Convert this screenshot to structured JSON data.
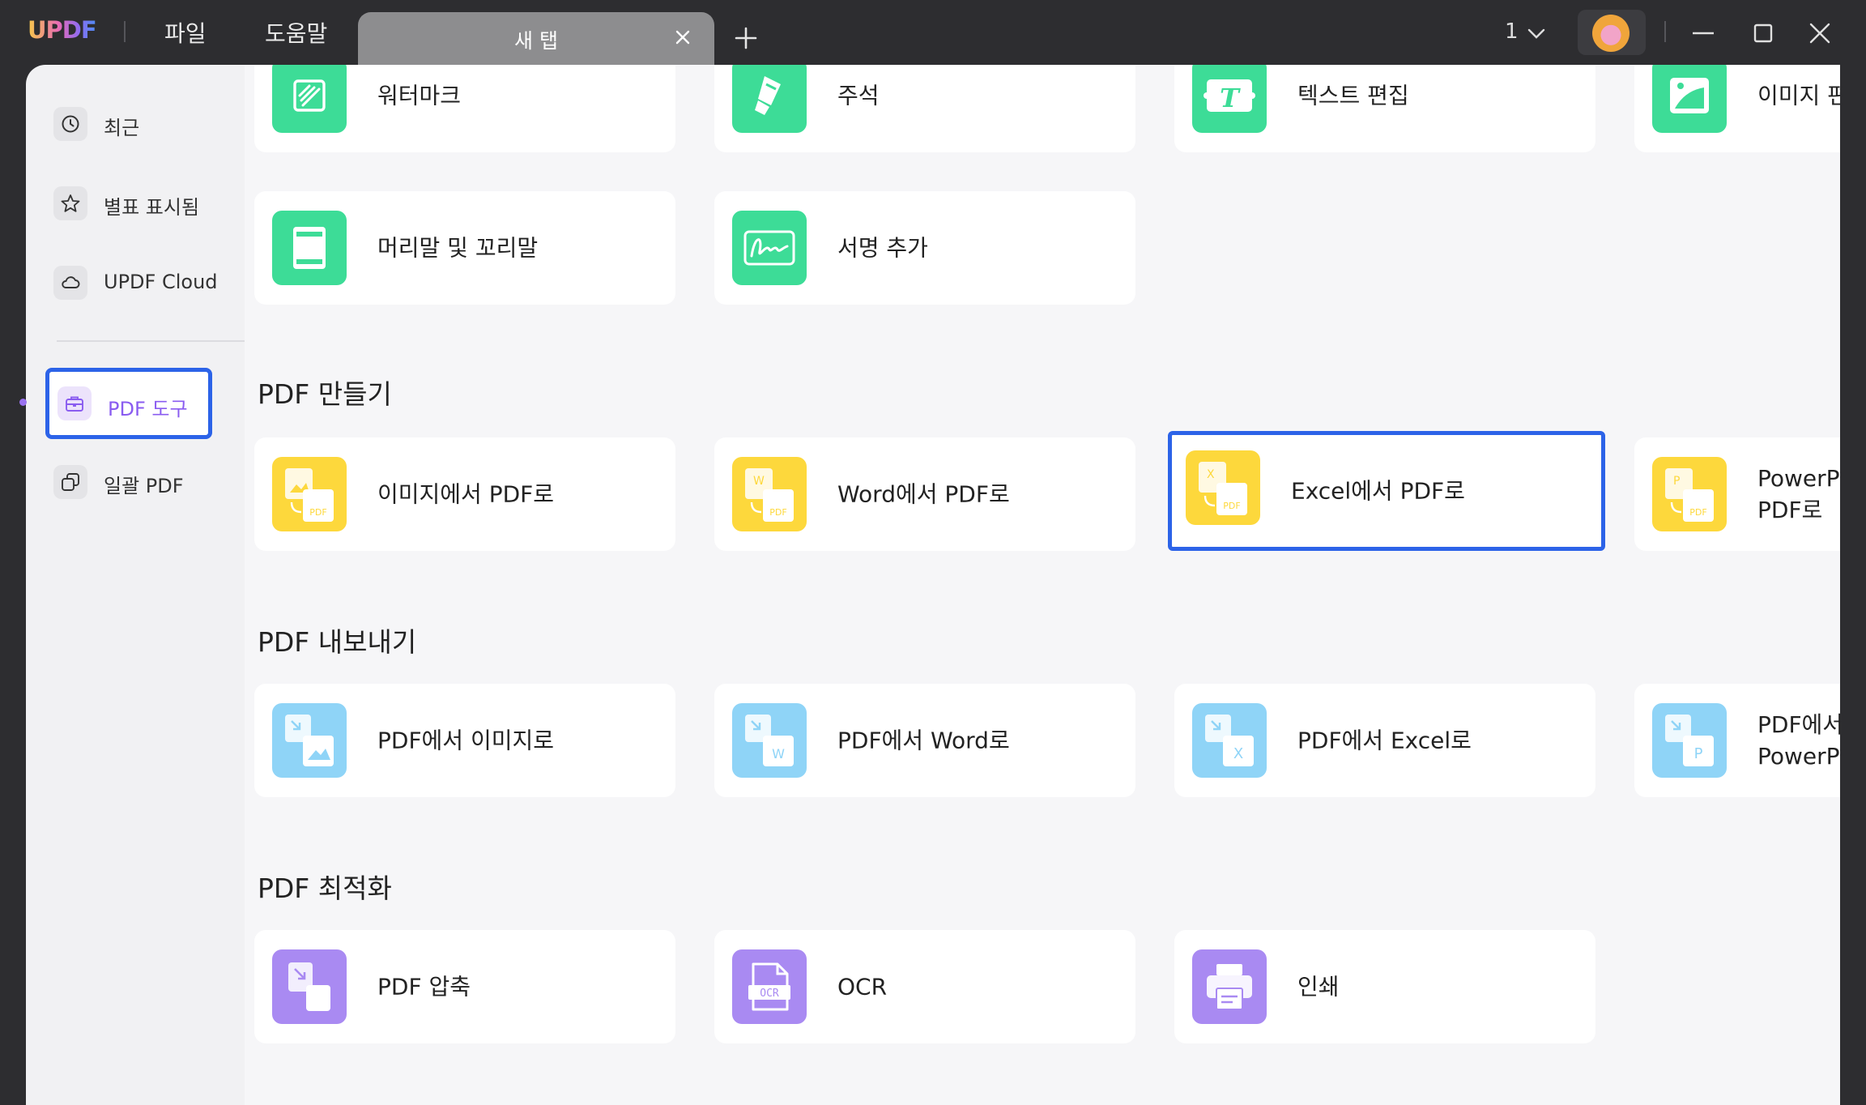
{
  "titlebar": {
    "app_logo": "UPDF",
    "menu_file": "파일",
    "menu_help": "도움말",
    "active_tab": "새 탭",
    "page_count": "1"
  },
  "sidebar": {
    "items": [
      {
        "label": "최근",
        "icon": "clock-icon"
      },
      {
        "label": "별표 표시됨",
        "icon": "star-icon"
      },
      {
        "label": "UPDF Cloud",
        "icon": "cloud-icon"
      },
      {
        "label": "PDF 도구",
        "icon": "toolbox-icon",
        "active": true
      },
      {
        "label": "일괄 PDF",
        "icon": "batch-icon"
      }
    ]
  },
  "sections": {
    "edit": {
      "tools": [
        {
          "label": "워터마크",
          "icon": "watermark-icon"
        },
        {
          "label": "주석",
          "icon": "highlighter-icon"
        },
        {
          "label": "텍스트 편집",
          "icon": "text-edit-icon"
        },
        {
          "label": "이미지 편",
          "icon": "image-edit-icon"
        },
        {
          "label": "머리말 및 꼬리말",
          "icon": "header-footer-icon"
        },
        {
          "label": "서명 추가",
          "icon": "signature-icon"
        }
      ]
    },
    "create": {
      "title": "PDF 만들기",
      "tools": [
        {
          "label": "이미지에서 PDF로",
          "icon": "image-to-pdf-icon"
        },
        {
          "label": "Word에서 PDF로",
          "icon": "word-to-pdf-icon"
        },
        {
          "label": "Excel에서 PDF로",
          "icon": "excel-to-pdf-icon",
          "selected": true
        },
        {
          "label": "PowerPo PDF로",
          "icon": "ppt-to-pdf-icon"
        }
      ]
    },
    "export": {
      "title": "PDF 내보내기",
      "tools": [
        {
          "label": "PDF에서 이미지로",
          "icon": "pdf-to-image-icon"
        },
        {
          "label": "PDF에서 Word로",
          "icon": "pdf-to-word-icon"
        },
        {
          "label": "PDF에서 Excel로",
          "icon": "pdf-to-excel-icon"
        },
        {
          "label": "PDF에서 PowerPo",
          "icon": "pdf-to-ppt-icon"
        }
      ]
    },
    "optimize": {
      "title": "PDF 최적화",
      "tools": [
        {
          "label": "PDF 압축",
          "icon": "compress-icon"
        },
        {
          "label": "OCR",
          "icon": "ocr-icon"
        },
        {
          "label": "인쇄",
          "icon": "printer-icon"
        }
      ]
    }
  },
  "colors": {
    "accent_selection": "#2c63e8",
    "edit_green": "#3ddc97",
    "create_yellow": "#fdd83c",
    "export_blue": "#8fd4f7",
    "optimize_purple": "#a98af2",
    "active_nav_text": "#8a5cf0"
  }
}
